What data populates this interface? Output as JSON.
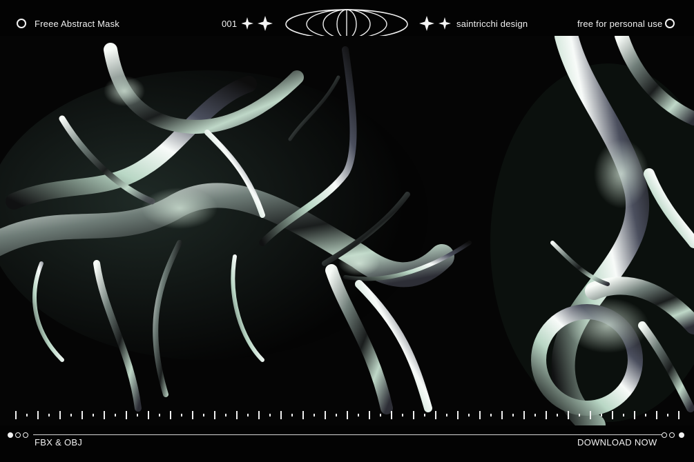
{
  "header": {
    "left_title": "Freee Abstract Mask",
    "number": "001",
    "brand": "saintricchi design",
    "license": "free for personal use"
  },
  "footer": {
    "formats": "FBX & OBJ",
    "cta": "DOWNLOAD NOW"
  },
  "icons": {
    "left_circle": "ring-icon",
    "right_circle": "ring-icon",
    "left_sparkles": "sparkle-icon",
    "right_sparkles": "sparkle-icon",
    "center_logo": "orbit-logo-icon"
  },
  "colors": {
    "background": "#030303",
    "text": "#f2f2f2",
    "chrome_highlight": "#d9e8dc"
  }
}
